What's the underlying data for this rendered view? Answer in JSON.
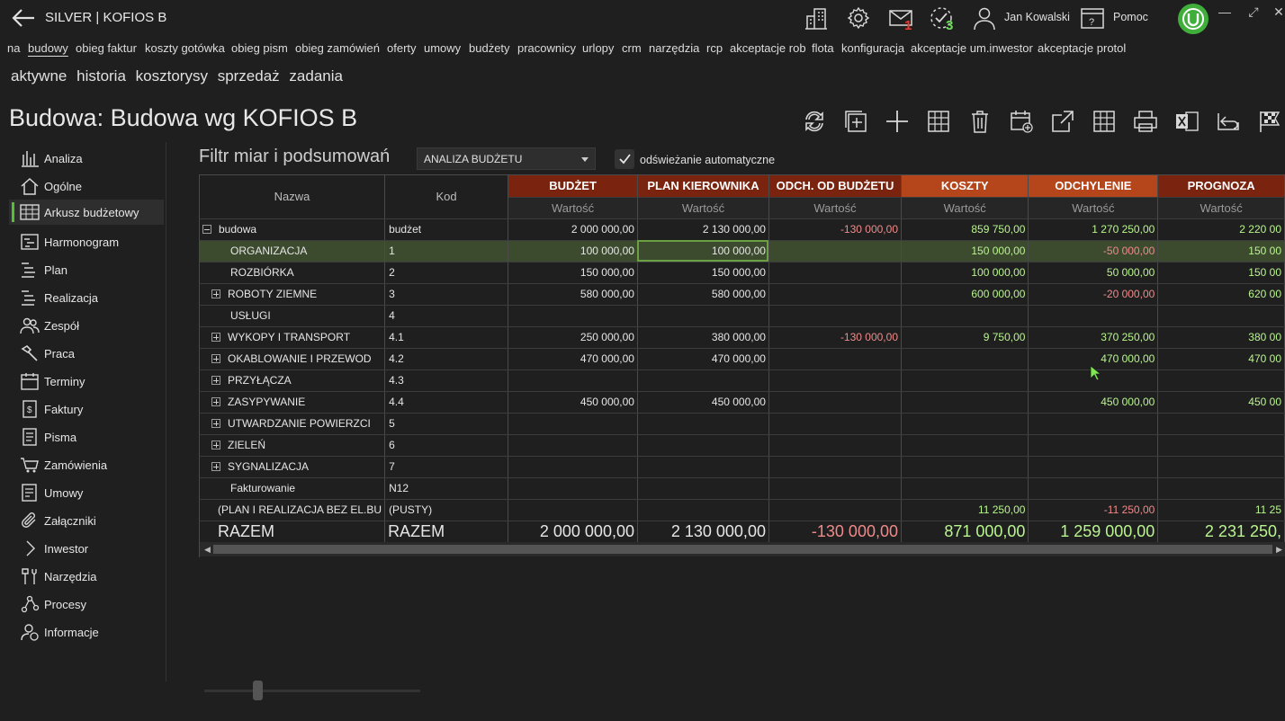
{
  "app": {
    "title": "SILVER | KOFIOS B",
    "user": "Jan Kowalski",
    "help": "Pomoc",
    "mail_count": "1",
    "tasks_count": "3"
  },
  "topnav": [
    "na",
    "budowy",
    "obieg faktur",
    "koszty gotówka",
    "obieg pism",
    "obieg zamówień",
    "oferty",
    "umowy",
    "budżety",
    "pracownicy",
    "urlopy",
    "crm",
    "narzędzia",
    "rcp",
    "akceptacje rob",
    "flota",
    "konfiguracja",
    "akceptacje um.inwestor",
    "akceptacje protol"
  ],
  "subnav": [
    "aktywne",
    "historia",
    "kosztorysy",
    "sprzedaż",
    "zadania"
  ],
  "page_title": "Budowa: Budowa wg KOFIOS B",
  "sidebar": [
    "Analiza",
    "Ogólne",
    "Arkusz budżetowy",
    "Harmonogram",
    "Plan",
    "Realizacja",
    "Zespół",
    "Praca",
    "Terminy",
    "Faktury",
    "Pisma",
    "Zamówienia",
    "Umowy",
    "Załączniki",
    "Inwestor",
    "Narzędzia",
    "Procesy",
    "Informacje"
  ],
  "filter": {
    "label": "Filtr miar i podsumowań",
    "selected": "ANALIZA BUDŻETU",
    "auto_refresh": "odświeżanie automatyczne"
  },
  "grid": {
    "col_name": "Nazwa",
    "col_code": "Kod",
    "groups": [
      "BUDŻET",
      "PLAN KIEROWNIKA",
      "ODCH. OD BUDŻETU",
      "KOSZTY",
      "ODCHYLENIE",
      "PROGNOZA"
    ],
    "group_colors": [
      "#7a2410",
      "#7a2410",
      "#7a2410",
      "#b5461c",
      "#b5461c",
      "#7a2410"
    ],
    "sub_label": "Wartość",
    "rows": [
      {
        "name": "budowa",
        "code": "budżet",
        "exp": "minus",
        "indent": 0,
        "v": [
          "2 000 000,00",
          "2 130 000,00",
          "-130 000,00",
          "859 750,00",
          "1 270 250,00",
          "2 220 00"
        ]
      },
      {
        "name": "ORGANIZACJA",
        "code": "1",
        "exp": "",
        "indent": 1,
        "v": [
          "100 000,00",
          "100 000,00",
          "",
          "150 000,00",
          "-50 000,00",
          "150 00"
        ]
      },
      {
        "name": "ROZBIÓRKA",
        "code": "2",
        "exp": "",
        "indent": 1,
        "v": [
          "150 000,00",
          "150 000,00",
          "",
          "100 000,00",
          "50 000,00",
          "150 00"
        ]
      },
      {
        "name": "ROBOTY ZIEMNE",
        "code": "3",
        "exp": "plus",
        "indent": 1,
        "v": [
          "580 000,00",
          "580 000,00",
          "",
          "600 000,00",
          "-20 000,00",
          "620 00"
        ]
      },
      {
        "name": "USŁUGI",
        "code": "4",
        "exp": "",
        "indent": 1,
        "v": [
          "",
          "",
          "",
          "",
          "",
          ""
        ]
      },
      {
        "name": "WYKOPY I TRANSPORT",
        "code": "4.1",
        "exp": "plus",
        "indent": 1,
        "v": [
          "250 000,00",
          "380 000,00",
          "-130 000,00",
          "9 750,00",
          "370 250,00",
          "380 00"
        ]
      },
      {
        "name": "OKABLOWANIE I PRZEWOD",
        "code": "4.2",
        "exp": "plus",
        "indent": 1,
        "v": [
          "470 000,00",
          "470 000,00",
          "",
          "",
          "470 000,00",
          "470 00"
        ]
      },
      {
        "name": "PRZYŁĄCZA",
        "code": "4.3",
        "exp": "plus",
        "indent": 1,
        "v": [
          "",
          "",
          "",
          "",
          "",
          ""
        ]
      },
      {
        "name": "ZASYPYWANIE",
        "code": "4.4",
        "exp": "plus",
        "indent": 1,
        "v": [
          "450 000,00",
          "450 000,00",
          "",
          "",
          "450 000,00",
          "450 00"
        ]
      },
      {
        "name": "UTWARDZANIE POWIERZCI",
        "code": "5",
        "exp": "plus",
        "indent": 1,
        "v": [
          "",
          "",
          "",
          "",
          "",
          ""
        ]
      },
      {
        "name": "ZIELEŃ",
        "code": "6",
        "exp": "plus",
        "indent": 1,
        "v": [
          "",
          "",
          "",
          "",
          "",
          ""
        ]
      },
      {
        "name": "SYGNALIZACJA",
        "code": "7",
        "exp": "plus",
        "indent": 1,
        "v": [
          "",
          "",
          "",
          "",
          "",
          ""
        ]
      },
      {
        "name": "Fakturowanie",
        "code": "N12",
        "exp": "",
        "indent": 1,
        "v": [
          "",
          "",
          "",
          "",
          "",
          ""
        ]
      },
      {
        "name": "(PLAN I REALIZACJA BEZ EL.BU",
        "code": "(PUSTY)",
        "exp": "",
        "indent": 0,
        "v": [
          "",
          "",
          "",
          "11 250,00",
          "-11 250,00",
          "11 25"
        ]
      }
    ],
    "total": {
      "name": "RAZEM",
      "code": "RAZEM",
      "v": [
        "2 000 000,00",
        "2 130 000,00",
        "-130 000,00",
        "871 000,00",
        "1 259 000,00",
        "2 231 250,"
      ]
    }
  },
  "colors": {
    "positive_green": "#b9f58f",
    "negative_red": "#f08a8a",
    "neutral": "#e6e6e6",
    "accent": "#52c234"
  }
}
